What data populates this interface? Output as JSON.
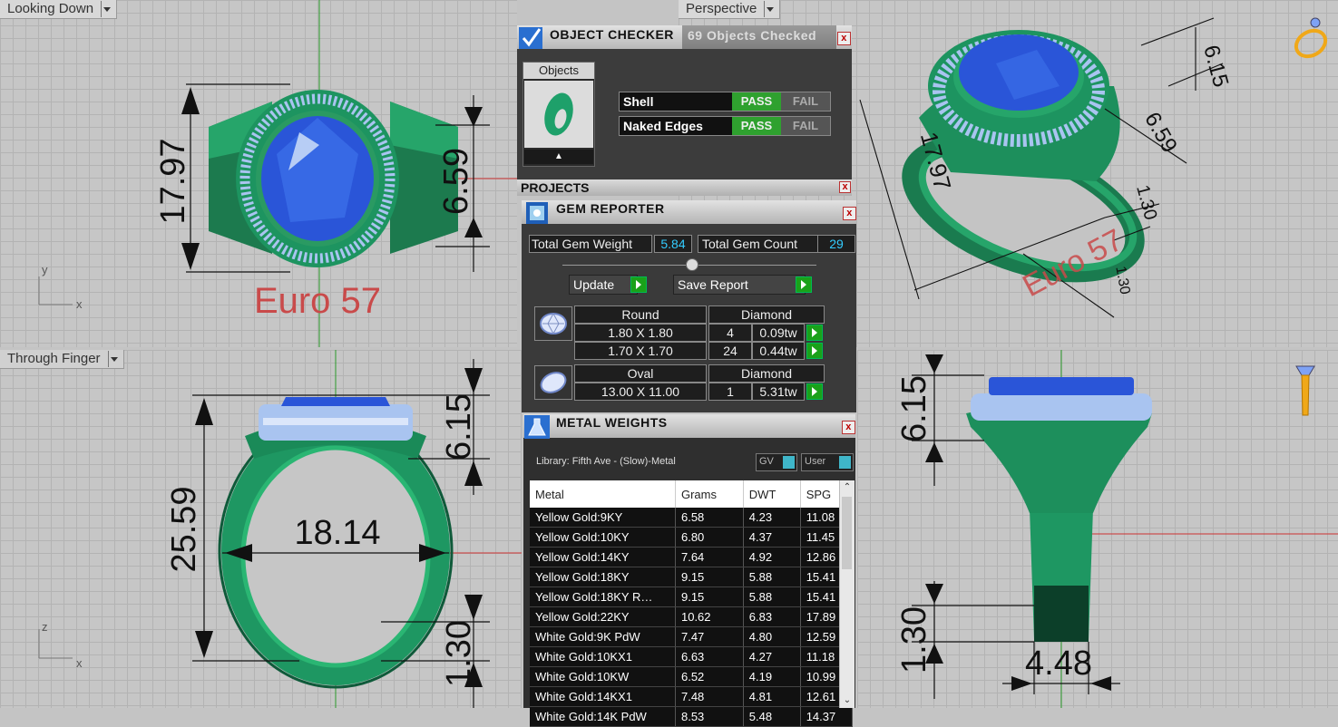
{
  "viewports": {
    "top": {
      "label": "Looking Down",
      "dim_height": "17.97",
      "dim_top": "6.59",
      "ring_size": "Euro 57",
      "axis_x": "x",
      "axis_y": "y"
    },
    "perspective": {
      "label": "Perspective",
      "dims": [
        "6.15",
        "6.59",
        "1.30",
        "17.97",
        "1.30"
      ],
      "ring_size": "Euro 57"
    },
    "front": {
      "label": "Through Finger",
      "dim_height": "25.59",
      "dim_width": "18.14",
      "dim_top": "6.15",
      "dim_bottom": "1.30",
      "axis_x": "x",
      "axis_z": "z"
    },
    "side": {
      "dim_top": "6.15",
      "dim_bottom": "1.30",
      "dim_width": "4.48"
    }
  },
  "object_checker": {
    "title": "OBJECT CHECKER",
    "status": "69  Objects Checked",
    "objects_label": "Objects",
    "rows": [
      {
        "label": "Shell",
        "pass": "PASS",
        "fail": "FAIL"
      },
      {
        "label": "Naked Edges",
        "pass": "PASS",
        "fail": "FAIL"
      }
    ]
  },
  "projects": {
    "title": "PROJECTS"
  },
  "gem_reporter": {
    "title": "GEM REPORTER",
    "total_weight_label": "Total Gem Weight",
    "total_weight": "5.84",
    "total_count_label": "Total Gem Count",
    "total_count": "29",
    "update": "Update",
    "save_report": "Save Report",
    "groups": [
      {
        "shape": "Round",
        "material": "Diamond",
        "rows": [
          {
            "size": "1.80 X 1.80",
            "count": "4",
            "weight": "0.09tw"
          },
          {
            "size": "1.70 X 1.70",
            "count": "24",
            "weight": "0.44tw"
          }
        ]
      },
      {
        "shape": "Oval",
        "material": "Diamond",
        "rows": [
          {
            "size": "13.00 X 11.00",
            "count": "1",
            "weight": "5.31tw"
          }
        ]
      }
    ]
  },
  "metal_weights": {
    "title": "METAL WEIGHTS",
    "library": "Library: Fifth Ave - (Slow)-Metal",
    "gv": "GV",
    "user": "User",
    "columns": [
      "Metal",
      "Grams",
      "DWT",
      "SPG"
    ],
    "rows": [
      [
        "Yellow Gold:9KY",
        "6.58",
        "4.23",
        "11.08"
      ],
      [
        "Yellow Gold:10KY",
        "6.80",
        "4.37",
        "11.45"
      ],
      [
        "Yellow Gold:14KY",
        "7.64",
        "4.92",
        "12.86"
      ],
      [
        "Yellow Gold:18KY",
        "9.15",
        "5.88",
        "15.41"
      ],
      [
        "Yellow Gold:18KY R…",
        "9.15",
        "5.88",
        "15.41"
      ],
      [
        "Yellow Gold:22KY",
        "10.62",
        "6.83",
        "17.89"
      ],
      [
        "White Gold:9K PdW",
        "7.47",
        "4.80",
        "12.59"
      ],
      [
        "White Gold:10KX1",
        "6.63",
        "4.27",
        "11.18"
      ],
      [
        "White Gold:10KW",
        "6.52",
        "4.19",
        "10.99"
      ],
      [
        "White Gold:14KX1",
        "7.48",
        "4.81",
        "12.61"
      ],
      [
        "White Gold:14K PdW",
        "8.53",
        "5.48",
        "14.37"
      ]
    ]
  },
  "colors": {
    "ring": "#1f9a63",
    "ring_dark": "#0c3f29",
    "gem": "#2a55d8",
    "halo": "#a9c4f0",
    "dimension_text": "#c94a4a",
    "pass": "#2fa12f"
  }
}
